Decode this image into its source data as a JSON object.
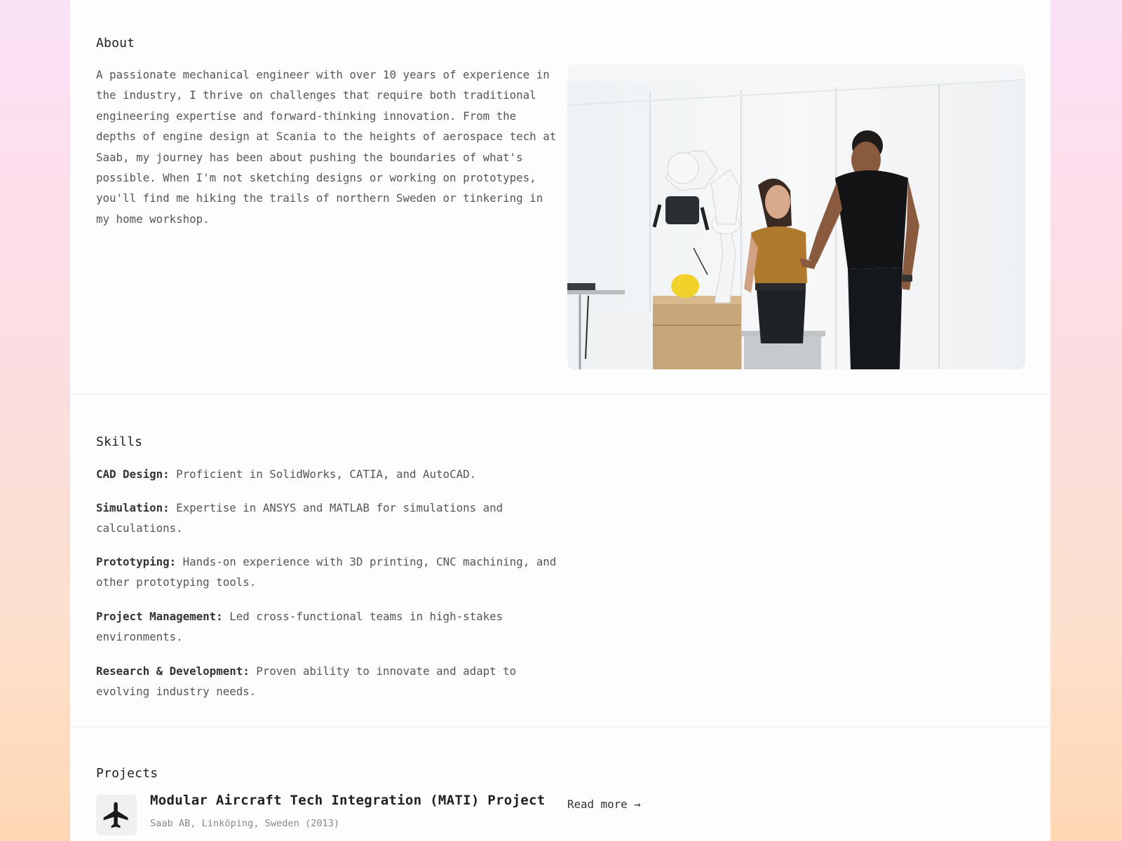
{
  "about": {
    "title": "About",
    "paragraph": "A passionate mechanical engineer with over 10 years of experience in the industry, I thrive on challenges that require both traditional engineering expertise and forward-thinking innovation. From the depths of engine design at Scania to the heights of aerospace tech at Saab, my journey has been about pushing the boundaries of what's possible. When I'm not sketching designs or working on prototypes, you'll find me hiking the trails of northern Sweden or tinkering in my home workshop."
  },
  "skills": {
    "title": "Skills",
    "items": [
      {
        "name": "CAD Design:",
        "desc": "Proficient in SolidWorks, CATIA, and AutoCAD."
      },
      {
        "name": "Simulation:",
        "desc": "Expertise in ANSYS and MATLAB for simulations and calculations."
      },
      {
        "name": "Prototyping:",
        "desc": "Hands-on experience with 3D printing, CNC machining, and other prototyping tools."
      },
      {
        "name": "Project Management:",
        "desc": "Led cross-functional teams in high-stakes environments."
      },
      {
        "name": "Research & Development:",
        "desc": "Proven ability to innovate and adapt to evolving industry needs."
      }
    ]
  },
  "projects": {
    "title": "Projects",
    "items": [
      {
        "icon": "airplane-icon",
        "title": "Modular Aircraft Tech Integration (MATI) Project",
        "meta": "Saab AB, Linköping, Sweden (2013)",
        "link_label": "Read more →"
      }
    ]
  }
}
